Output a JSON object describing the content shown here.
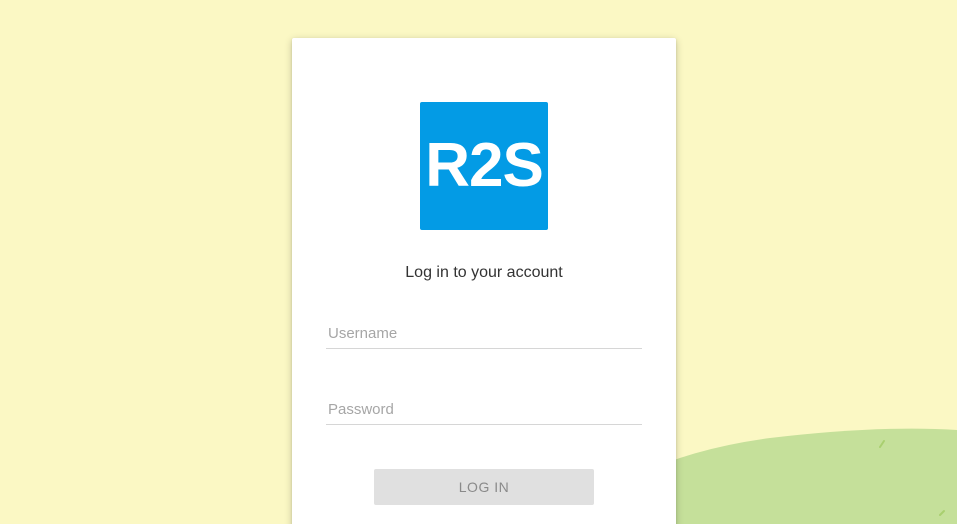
{
  "colors": {
    "background": "#fbf8c4",
    "hill": "#c5e09a",
    "logo_background": "#039be5",
    "button_background": "#e0e0e0"
  },
  "logo": {
    "text": "R2S"
  },
  "login": {
    "heading": "Log in to your account",
    "username_placeholder": "Username",
    "password_placeholder": "Password",
    "button_label": "LOG IN"
  }
}
